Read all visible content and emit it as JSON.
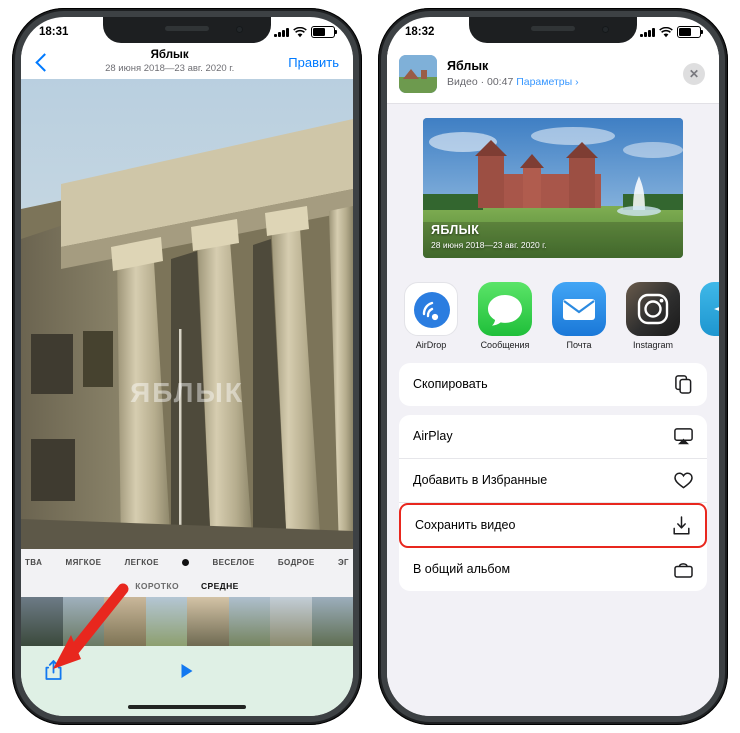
{
  "left_phone": {
    "status": {
      "time": "18:31",
      "signal_bars": 4,
      "wifi": "wifi-icon",
      "battery": "battery-icon"
    },
    "nav": {
      "back": "back-chevron",
      "title": "Яблык",
      "subtitle": "28 июня 2018—23 авг. 2020 г.",
      "edit": "Править"
    },
    "watermark": "ЯБЛЫК",
    "filters": [
      "ТВА",
      "МЯГКОЕ",
      "ЛЕГКОЕ",
      "ВЕСЕЛОЕ",
      "БОДРОЕ",
      "ЭГ"
    ],
    "levels": {
      "items": [
        "КОРОТКО",
        "СРЕДНЕ"
      ],
      "active": "СРЕДНЕ"
    },
    "toolbar": {
      "share": "share-icon",
      "play": "play-button"
    }
  },
  "right_phone": {
    "status": {
      "time": "18:32",
      "signal_bars": 4,
      "wifi": "wifi-icon",
      "battery": "battery-icon"
    },
    "sheet": {
      "title": "Яблык",
      "subtitle": "Видео · 00:47",
      "params_link": "Параметры",
      "params_chevron": "›",
      "close": "✕",
      "preview_caption_title": "ЯБЛЫК",
      "preview_caption_sub": "28 июня 2018—23 авг. 2020 г.",
      "apps": [
        {
          "label": "AirDrop",
          "icon": "airdrop-icon"
        },
        {
          "label": "Сообщения",
          "icon": "messages-icon"
        },
        {
          "label": "Почта",
          "icon": "mail-icon"
        },
        {
          "label": "Instagram",
          "icon": "instagram-icon"
        },
        {
          "label": "",
          "icon": "telegram-icon"
        }
      ],
      "actions": [
        {
          "label": "Скопировать",
          "icon": "copy-icon",
          "highlighted": false
        },
        {
          "label": "AirPlay",
          "icon": "airplay-icon",
          "highlighted": false
        },
        {
          "label": "Добавить в Избранные",
          "icon": "heart-icon",
          "highlighted": false
        },
        {
          "label": "Сохранить видео",
          "icon": "download-icon",
          "highlighted": true
        },
        {
          "label": "В общий альбом",
          "icon": "shared-album-icon",
          "highlighted": false
        }
      ]
    }
  },
  "annotation": {
    "arrow": "red-arrow-pointing-to-share-button",
    "color": "#e8271e"
  }
}
